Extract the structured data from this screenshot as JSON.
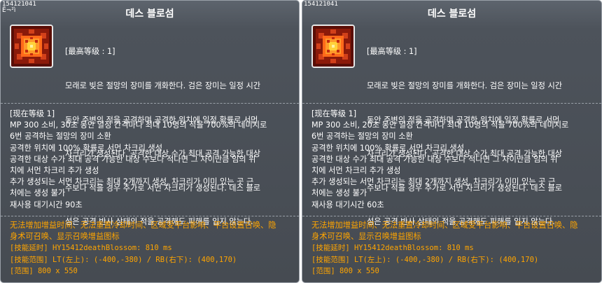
{
  "panels": [
    {
      "skill_id": "154121041",
      "flag": "Ë¬²ì",
      "title": "데스 블로섬",
      "master_level": "[最高等级 : 1]",
      "desc_lines": [
        "모래로 빚은 절망의 장미를 개화한다. 검은 장미는 일정 시간",
        "동안 주변의 적을 공격하며 공격한 위치에 일정 확률로 서먼",
        "차크리가 생성된다. 공격한 대상 수가 최대 공격 가능한 대상",
        "수보다 적을 경우 추가로 서먼 차크리가 생성된다. 데스 블로",
        "섬은 공격 반사 상태의 적을 공격해도 피해를 입지 않는다."
      ],
      "current_level": "[现在等级 1]",
      "current_lines": [
        "MP 300 소비, 30초 동안 일정 간격마다 최대 10명의 적을 700%의 데미지로",
        "6번 공격하는 절망의 장미 소환",
        "공격한 위치에 100% 확률로 서먼 차크리 생성",
        "공격한 대상 수가 최대 공격 가능한 대상 수보다 적다면 그 차이만큼 임의 위",
        "치에 서먼 차크리 추가 생성",
        "추가 생성되는 서먼 차크리는 최대 2개까지 생성, 차크리가 이미 있는 곳 근",
        "처에는 생성 불가",
        "재사용 대기시간 90초"
      ],
      "tips": {
        "line1": "无法增加增益时间、无法重置冷却时间、区域受平台影响、平台设置召唤、隐",
        "line2": "身术可召唤、显示召唤增益图标",
        "delay": "[技能延时] HY15412deathBlossom: 810 ms",
        "range": "[技能范围] LT(左上): (-400,-380) / RB(右下): (400,170)",
        "area": "[范围] 800 x 550"
      }
    },
    {
      "skill_id": "154121041",
      "flag": "",
      "title": "데스 블로섬",
      "master_level": "[最高等级 : 1]",
      "desc_lines": [
        "모래로 빚은 절망의 장미를 개화한다. 검은 장미는 일정 시간",
        "동안 주변의 적을 공격하며 공격한 위치에 일정 확률로 서먼",
        "차크리가 생성된다. 공격한 대상 수가 최대 공격 가능한 대상",
        "수보다 적을 경우 추가로 서먼 차크리가 생성된다. 데스 블로",
        "섬은 공격 반사 상태의 적을 공격해도 피해를 입지 않는다."
      ],
      "current_level": "[现在等级 1]",
      "current_lines": [
        "MP 300 소비, 20초 동안 일정 간격마다 최대 10명의 적을 700%의 데미지로",
        "6번 공격하는 절망의 장미 소환",
        "공격한 위치에 100% 확률로 서먼 차크리 생성",
        "공격한 대상 수가 최대 공격 가능한 대상 수보다 적다면 그 차이만큼 임의 위",
        "치에 서먼 차크리 추가 생성",
        "추가 생성되는 서먼 차크리는 최대 2개까지 생성, 차크리가 이미 있는 곳 근",
        "처에는 생성 불가",
        "재사용 대기시간 60초"
      ],
      "tips": {
        "line1": "无法增加增益时间、无法重置冷却时间、区域受平台影响、平台设置召唤、隐",
        "line2": "身术可召唤、显示召唤增益图标",
        "delay": "[技能延时] HY15412deathBlossom: 810 ms",
        "range": "[技能范围] LT(左上): (-400,-380) / RB(右下): (400,170)",
        "area": "[范围] 800 x 550"
      }
    }
  ],
  "icon": {
    "name": "death-blossom-skill-icon",
    "colors": {
      "base": "#8b1a0a",
      "glow": "#ff6a1a",
      "core": "#ffd23a",
      "frame": "#e8e8e8"
    }
  },
  "colors": {
    "panel_bg": "#4d535b",
    "text": "#ffffff",
    "tip": "#ffa500",
    "border": "#9aa0a8"
  }
}
